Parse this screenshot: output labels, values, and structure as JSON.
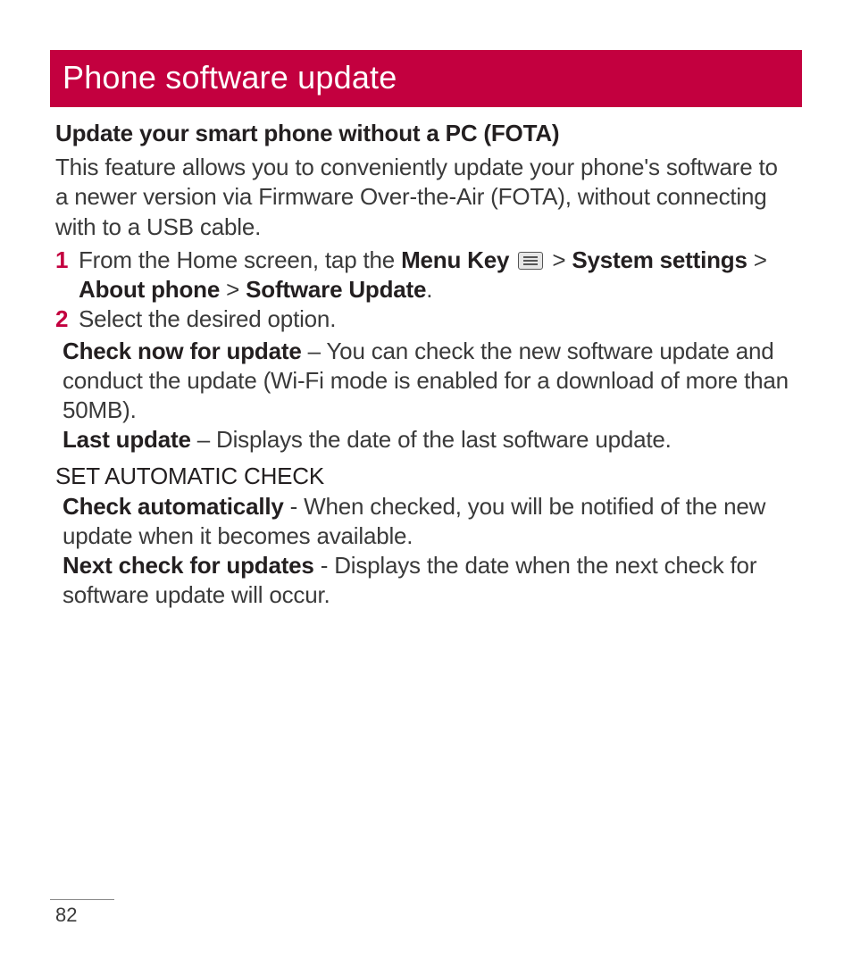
{
  "title": "Phone software update",
  "subhead": "Update your smart phone without a PC (FOTA)",
  "intro": "This feature allows you to conveniently update your phone's software to a newer version via Firmware Over-the-Air (FOTA), without connecting with to a USB cable.",
  "steps": {
    "one": {
      "num": "1",
      "pre": "From the Home screen, tap the ",
      "menu_key": "Menu Key",
      "gt1": " > ",
      "sys": "System settings",
      "gt2": " > ",
      "about": "About phone",
      "gt3": " > ",
      "sw": "Software Update",
      "period": "."
    },
    "two": {
      "num": "2",
      "text": "Select the desired option."
    }
  },
  "defs": {
    "check_now": {
      "label": "Check now for update",
      "text": " – You can check the new software update and conduct the update (Wi-Fi mode is enabled for a download of more than 50MB)."
    },
    "last_update": {
      "label": "Last update",
      "text": " – Displays the date of the last software update."
    }
  },
  "section_caps": "SET AUTOMATIC CHECK",
  "auto": {
    "check_auto": {
      "label": "Check automatically",
      "text": " - When checked, you will be notified of the new update when it becomes available."
    },
    "next_check": {
      "label": "Next check for updates",
      "text": " - Displays the date when the next check for software update will occur."
    }
  },
  "page_number": "82"
}
